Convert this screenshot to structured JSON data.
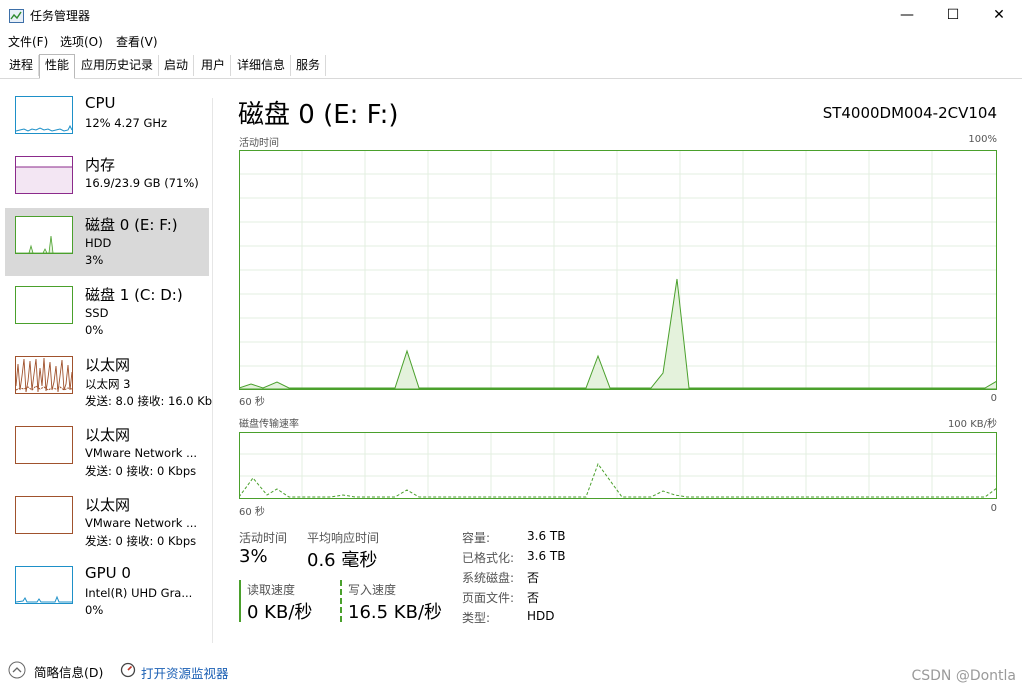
{
  "window": {
    "title": "任务管理器",
    "controls": {
      "minimize": "—",
      "maximize": "☐",
      "close": "✕"
    }
  },
  "menu": [
    "文件(F)",
    "选项(O)",
    "查看(V)"
  ],
  "tabs": [
    "进程",
    "性能",
    "应用历史记录",
    "启动",
    "用户",
    "详细信息",
    "服务"
  ],
  "active_tab": 1,
  "sidebar": {
    "items": [
      {
        "title": "CPU",
        "lines": [
          "12%  4.27 GHz"
        ],
        "color": "#1e90c8",
        "kind": "cpu"
      },
      {
        "title": "内存",
        "lines": [
          "16.9/23.9 GB (71%)"
        ],
        "color": "#8b2a8b",
        "kind": "memory"
      },
      {
        "title": "磁盘 0 (E: F:)",
        "lines": [
          "HDD",
          "3%"
        ],
        "color": "#4aa02c",
        "kind": "disk0",
        "selected": true
      },
      {
        "title": "磁盘 1 (C: D:)",
        "lines": [
          "SSD",
          "0%"
        ],
        "color": "#4aa02c",
        "kind": "disk1"
      },
      {
        "title": "以太网",
        "lines": [
          "以太网 3",
          "发送: 8.0  接收: 16.0 Kb"
        ],
        "color": "#a0522d",
        "kind": "eth"
      },
      {
        "title": "以太网",
        "lines": [
          "VMware Network ...",
          "发送: 0  接收: 0 Kbps"
        ],
        "color": "#a0522d",
        "kind": "empty"
      },
      {
        "title": "以太网",
        "lines": [
          "VMware Network ...",
          "发送: 0  接收: 0 Kbps"
        ],
        "color": "#a0522d",
        "kind": "empty"
      },
      {
        "title": "GPU 0",
        "lines": [
          "Intel(R) UHD Gra...",
          "0%"
        ],
        "color": "#1e90c8",
        "kind": "gpu"
      }
    ]
  },
  "main": {
    "title": "磁盘 0 (E: F:)",
    "model": "ST4000DM004-2CV104",
    "graph1": {
      "label": "活动时间",
      "max": "100%",
      "left": "60 秒",
      "right": "0"
    },
    "graph2": {
      "label": "磁盘传输速率",
      "max": "100 KB/秒",
      "left": "60 秒",
      "right": "0"
    },
    "stats": {
      "active_label": "活动时间",
      "active_value": "3%",
      "resp_label": "平均响应时间",
      "resp_value": "0.6 毫秒",
      "read_label": "读取速度",
      "read_value": "0 KB/秒",
      "write_label": "写入速度",
      "write_value": "16.5 KB/秒"
    },
    "info": [
      {
        "label": "容量:",
        "value": "3.6 TB"
      },
      {
        "label": "已格式化:",
        "value": "3.6 TB"
      },
      {
        "label": "系统磁盘:",
        "value": "否"
      },
      {
        "label": "页面文件:",
        "value": "否"
      },
      {
        "label": "类型:",
        "value": "HDD"
      }
    ],
    "accent": "#4aa02c"
  },
  "footer": {
    "brief": "简略信息(D)",
    "monitor": "打开资源监视器",
    "watermark": "CSDN @Dontla"
  }
}
